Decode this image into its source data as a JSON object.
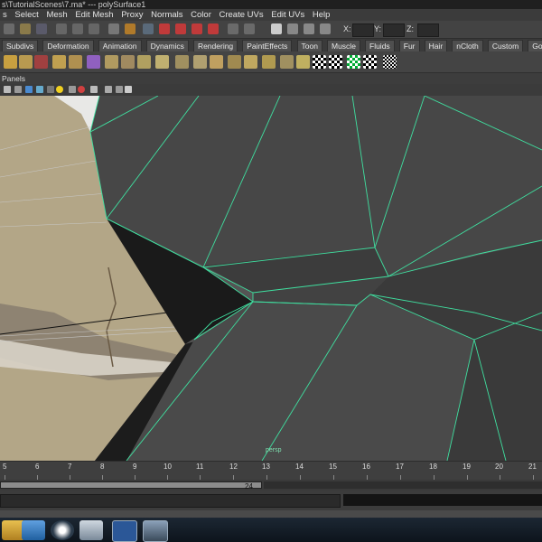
{
  "window": {
    "title": "s\\TutorialScenes\\7.ma*  ---  polySurface1"
  },
  "menubar": {
    "items": [
      "s",
      "Select",
      "Mesh",
      "Edit Mesh",
      "Proxy",
      "Normals",
      "Color",
      "Create UVs",
      "Edit UVs",
      "Help"
    ]
  },
  "statusline": {
    "x_label": "X:",
    "y_label": "Y:",
    "z_label": "Z:",
    "x_value": "",
    "y_value": "",
    "z_value": ""
  },
  "shelf": {
    "tabs": [
      "Subdivs",
      "Deformation",
      "Animation",
      "Dynamics",
      "Rendering",
      "PaintEffects",
      "Toon",
      "Muscle",
      "Fluids",
      "Fur",
      "Hair",
      "nCloth",
      "Custom",
      "GoZBrush"
    ]
  },
  "panels": {
    "label": "Panels"
  },
  "viewport": {
    "camera_label": "persp"
  },
  "timeline": {
    "ticks": [
      "5",
      "6",
      "7",
      "8",
      "9",
      "10",
      "11",
      "12",
      "13",
      "14",
      "15",
      "16",
      "17",
      "18",
      "19",
      "20",
      "21"
    ]
  },
  "range": {
    "current": "24"
  },
  "colors": {
    "wire": "#3fe0a0",
    "face": "#4a4a4a",
    "ui": "#444444",
    "taskbar": "#0d141c"
  },
  "taskbar": {
    "items": [
      "windows-explorer-icon",
      "network-icon",
      "media-player-icon",
      "browser-icon",
      "word-icon",
      "maya-icon"
    ]
  }
}
